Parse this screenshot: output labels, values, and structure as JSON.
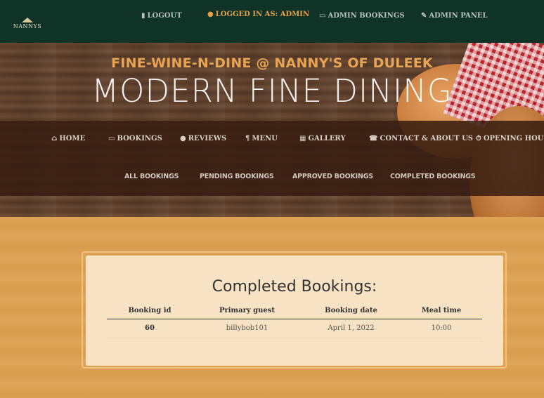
{
  "topbar": {
    "logo_text": "NANNYS",
    "items": [
      {
        "label": "LOGOUT",
        "icon": "door-exit-icon"
      },
      {
        "label": "LOGGED IN AS: ADMIN",
        "icon": "user-icon"
      },
      {
        "label": "ADMIN BOOKINGS",
        "icon": "book-icon"
      },
      {
        "label": "ADMIN PANEL",
        "icon": "pencil-icon"
      }
    ]
  },
  "hero": {
    "subtitle": "FINE-WINE-N-DINE @ NANNY'S OF DULEEK",
    "title": "MODERN FINE DINING"
  },
  "mainnav": {
    "items": [
      {
        "label": "HOME",
        "icon": "home-icon"
      },
      {
        "label": "BOOKINGS",
        "icon": "book-icon"
      },
      {
        "label": "REVIEWS",
        "icon": "speech-bubble-icon"
      },
      {
        "label": "MENU",
        "icon": "cutlery-icon"
      },
      {
        "label": "GALLERY",
        "icon": "images-icon"
      },
      {
        "label": "CONTACT & ABOUT US",
        "icon": "phone-icon"
      },
      {
        "label": "OPENING HOURS",
        "icon": "clock-icon"
      }
    ],
    "subitems": [
      "ALL BOOKINGS",
      "PENDING BOOKINGS",
      "APPROVED BOOKINGS",
      "COMPLETED BOOKINGS"
    ]
  },
  "card": {
    "title": "Completed Bookings:",
    "columns": [
      "Booking id",
      "Primary guest",
      "Booking date",
      "Meal time"
    ],
    "rows": [
      {
        "id": "60",
        "guest": "billybob101",
        "date": "April 1, 2022",
        "time": "10:00"
      }
    ]
  },
  "colors": {
    "topbar": "#0f3327",
    "accent": "#e7a453",
    "content_bg": "#d99d4f",
    "card_bg": "#f7e2c3"
  }
}
